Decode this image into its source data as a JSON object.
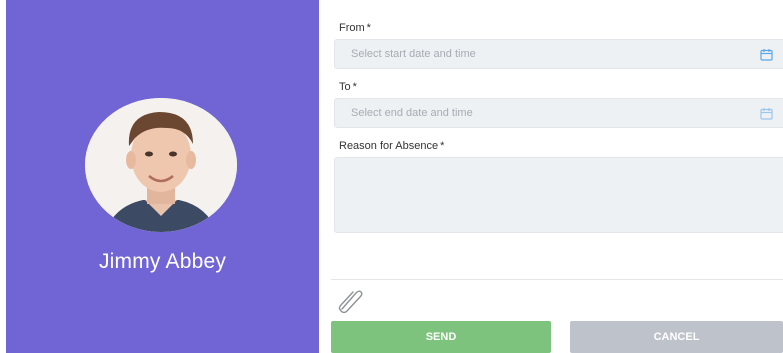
{
  "profile": {
    "name": "Jimmy Abbey"
  },
  "form": {
    "from": {
      "label": "From",
      "required_mark": "*",
      "placeholder": "Select start date and time"
    },
    "to": {
      "label": "To",
      "required_mark": "*",
      "placeholder": "Select end date and time"
    },
    "reason": {
      "label": "Reason for Absence",
      "required_mark": "*",
      "value": ""
    }
  },
  "actions": {
    "send_label": "SEND",
    "cancel_label": "CANCEL"
  },
  "colors": {
    "panel": "#7165d6",
    "send": "#7dc37d",
    "cancel": "#bec3cb",
    "calendar_icon": "#5aa9e6"
  }
}
